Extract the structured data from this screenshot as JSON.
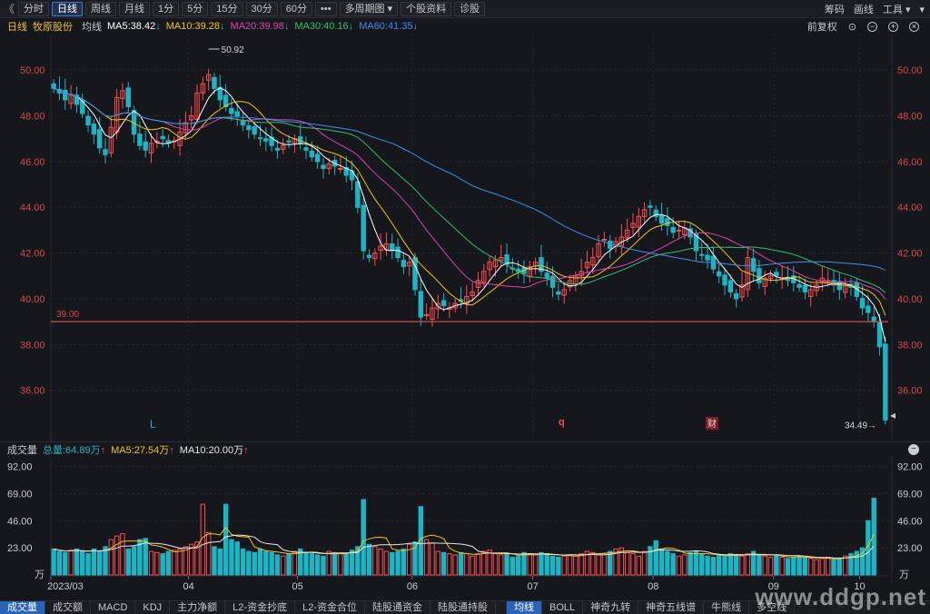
{
  "toolbar": {
    "back": "《",
    "periods": [
      "分时",
      "日线",
      "周线",
      "月线",
      "1分",
      "5分",
      "15分",
      "30分",
      "60分"
    ],
    "active_period": 1,
    "more": "•••",
    "multi_period": "多周期图 ▾",
    "stock_info": "个股资料",
    "diagnose": "诊股",
    "chip": "筹码",
    "draw": "画线",
    "tools": "工具 ▾",
    "pin": "▾"
  },
  "ma_header": {
    "period": "日线",
    "stock_name": "牧原股份",
    "avg_label": "均线",
    "ma5": "MA5:38.42",
    "ma10": "MA10:39.28",
    "ma20": "MA20:39.98",
    "ma30": "MA30:40.16",
    "ma60": "MA60:41.35",
    "arrow": "↓",
    "adjust": "前复权",
    "lock": "⊙",
    "minus": "−",
    "plus": "+",
    "close": "×"
  },
  "colors": {
    "ma5": "#ffffff",
    "ma10": "#f5c518",
    "ma20": "#e040b8",
    "ma30": "#2ec26a",
    "ma60": "#3b8ef0",
    "up": "#ff4d4f",
    "down": "#1bb6c6",
    "hline": "#d94848"
  },
  "price_axis": [
    "50.00",
    "48.00",
    "46.00",
    "44.00",
    "42.00",
    "40.00",
    "38.00",
    "36.00"
  ],
  "annotations": {
    "high": "50.92",
    "low": "34.49",
    "hline": "39.00",
    "marker_l": "L",
    "marker_q": "q",
    "marker_cai": "财"
  },
  "volume_header": {
    "title": "成交量",
    "total": "总量:64.89万",
    "ma5": "MA5:27.54万",
    "ma10": "MA10:20.00万",
    "arrow": "↑",
    "collapse": "−"
  },
  "volume_axis": [
    "92.00",
    "69.00",
    "46.00",
    "23.00"
  ],
  "volume_unit": "万",
  "date_axis": [
    "2023/03",
    "04",
    "05",
    "06",
    "07",
    "08",
    "09",
    "10"
  ],
  "bottom_tabs_left": [
    "成交量",
    "成交额",
    "MACD",
    "KDJ",
    "主力净额",
    "L2-资金抄底",
    "L2-资金合位",
    "陆股通资金",
    "陆股通持股"
  ],
  "bottom_tabs_right": [
    "均线",
    "BOLL",
    "神奇九转",
    "神奇五线谱",
    "牛熊线",
    "多空线"
  ],
  "watermark": "www.ddgp.net",
  "chart_data": [
    {
      "type": "candlestick",
      "title": "牧原股份",
      "ylim": [
        34,
        51
      ],
      "ma_series": [
        {
          "name": "MA5",
          "last": 38.42
        },
        {
          "name": "MA10",
          "last": 39.28
        },
        {
          "name": "MA20",
          "last": 39.98
        },
        {
          "name": "MA30",
          "last": 40.16
        },
        {
          "name": "MA60",
          "last": 41.35
        }
      ],
      "markers": {
        "high": 50.92,
        "low": 34.49,
        "hline": 39.0
      },
      "closes": [
        49.2,
        49.0,
        48.7,
        48.9,
        48.5,
        48.1,
        47.6,
        47.2,
        46.6,
        46.3,
        47.5,
        48.8,
        49.1,
        48.4,
        47.2,
        46.7,
        46.5,
        46.8,
        46.9,
        47.0,
        46.8,
        46.9,
        47.3,
        47.7,
        48.0,
        49.0,
        49.4,
        49.8,
        49.2,
        48.7,
        48.4,
        48.1,
        48.0,
        47.6,
        47.4,
        47.2,
        47.0,
        46.9,
        46.7,
        46.5,
        46.7,
        46.9,
        47.0,
        46.8,
        46.5,
        46.2,
        46.0,
        45.7,
        45.9,
        45.8,
        45.7,
        45.4,
        45.2,
        44.0,
        42.1,
        41.8,
        42.0,
        42.3,
        42.4,
        42.1,
        41.8,
        41.4,
        41.6,
        40.4,
        39.2,
        39.3,
        39.6,
        39.8,
        39.7,
        39.6,
        39.8,
        39.9,
        40.1,
        40.3,
        40.8,
        41.2,
        41.6,
        41.7,
        41.8,
        41.5,
        41.3,
        41.2,
        41.1,
        41.4,
        41.6,
        41.2,
        40.9,
        40.5,
        40.2,
        40.4,
        40.8,
        41.0,
        41.2,
        41.6,
        41.8,
        42.4,
        42.6,
        42.2,
        42.5,
        42.7,
        43.0,
        43.3,
        43.6,
        43.9,
        44.0,
        43.6,
        43.3,
        43.2,
        42.9,
        43.0,
        43.1,
        42.7,
        42.1,
        41.9,
        41.7,
        41.3,
        41.0,
        40.6,
        40.3,
        40.0,
        40.6,
        41.8,
        41.2,
        40.7,
        40.9,
        41.0,
        41.0,
        40.9,
        40.8,
        40.7,
        40.5,
        40.3,
        40.4,
        40.6,
        40.9,
        40.8,
        40.6,
        40.4,
        40.6,
        40.5,
        40.1,
        39.6,
        39.4,
        39.0,
        37.9,
        34.7
      ],
      "volumes": [
        22,
        20,
        19,
        21,
        22,
        20,
        18,
        22,
        20,
        24,
        30,
        33,
        35,
        22,
        24,
        30,
        31,
        20,
        19,
        18,
        20,
        21,
        22,
        24,
        26,
        28,
        60,
        36,
        24,
        22,
        60,
        30,
        28,
        22,
        20,
        19,
        22,
        20,
        19,
        17,
        16,
        18,
        20,
        22,
        19,
        18,
        17,
        16,
        20,
        19,
        18,
        18,
        21,
        24,
        64,
        26,
        24,
        22,
        20,
        19,
        20,
        22,
        26,
        28,
        58,
        30,
        27,
        20,
        19,
        18,
        17,
        19,
        18,
        16,
        18,
        20,
        21,
        18,
        17,
        18,
        15,
        16,
        19,
        18,
        17,
        19,
        18,
        16,
        15,
        16,
        17,
        16,
        18,
        20,
        19,
        17,
        18,
        20,
        22,
        23,
        19,
        18,
        16,
        20,
        24,
        29,
        22,
        20,
        18,
        16,
        17,
        19,
        20,
        18,
        16,
        15,
        17,
        16,
        18,
        17,
        16,
        18,
        20,
        17,
        16,
        15,
        17,
        15,
        14,
        15,
        16,
        15,
        14,
        13,
        14,
        15,
        13,
        14,
        16,
        18,
        20,
        23,
        46,
        65
      ]
    }
  ]
}
